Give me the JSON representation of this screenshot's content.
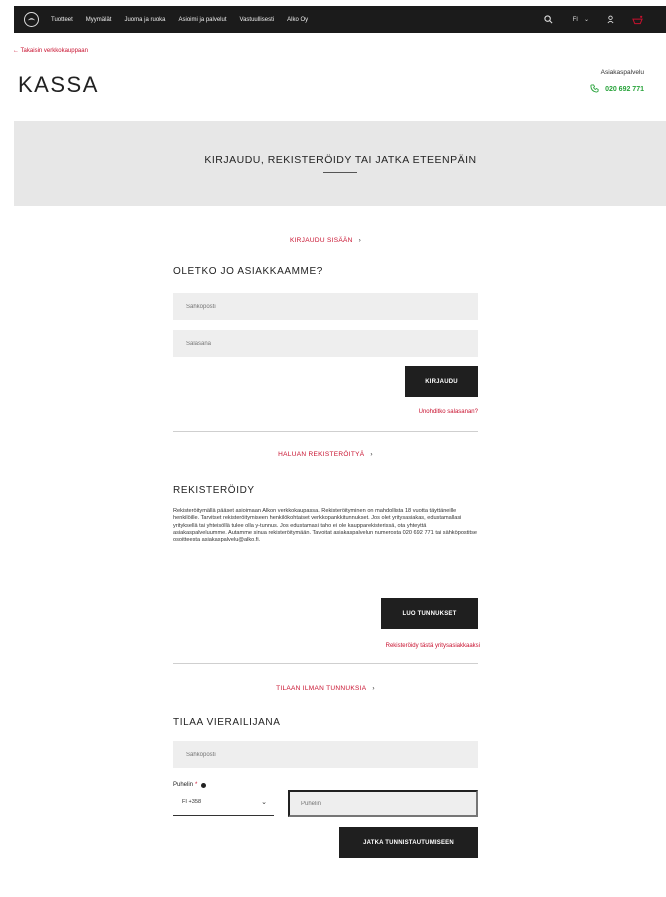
{
  "header": {
    "nav": [
      "Tuotteet",
      "Myymälät",
      "Juoma ja ruoka",
      "Asioimi ja palvelut",
      "Vastuullisesti",
      "Alko Oy"
    ],
    "language": "FI"
  },
  "back_link": "← Takaisin verkkokauppaan",
  "page_title": "KASSA",
  "customer_service": {
    "label": "Asiakaspalvelu",
    "phone": "020 692 771"
  },
  "hero": {
    "title": "KIRJAUDU, REKISTERÖIDY TAI JATKA ETEENPÄIN"
  },
  "login": {
    "toggle": "KIRJAUDU SISÄÄN",
    "heading": "OLETKO JO ASIAKKAAMME?",
    "email_placeholder": "Sähköposti",
    "password_placeholder": "Salasana",
    "button": "KIRJAUDU",
    "forgot": "Unohditko salasanan?"
  },
  "register": {
    "toggle": "HALUAN REKISTERÖITYÄ",
    "heading": "REKISTERÖIDY",
    "paragraph": "Rekisteröitymällä pääset asioimaan Alkon verkkokaupassa. Rekisteröityminen on mahdollista 18 vuotta täyttäneille henkilöille. Tarvitset rekisteröitymiseen henkilökohtaiset verkkopankkitunnukset. Jos olet yritysasiakas, edustamallasi yrityksellä tai yhteisöllä tulee olla y-tunnus. Jos edustamasi taho ei ole kaupparekisterissä, ota yhteyttä asiakaspalveluumme. Autamme sinua rekisteröitymään. Tavoitat asiakaspalvelun numerosta 020 692 771 tai sähköpostitse osoitteesta asiakaspalvelu@alko.fi.",
    "button": "LUO TUNNUKSET",
    "business_link": "Rekisteröidy tästä yritysasiakkaaksi"
  },
  "guest": {
    "toggle": "TILAAN ILMAN TUNNUKSIA",
    "heading": "TILAA VIERAILIJANA",
    "email_placeholder": "Sähköposti",
    "phone_label": "Puhelin",
    "required_mark": "*",
    "country_code": "FI +358",
    "phone_placeholder": "Puhelin",
    "button": "JATKA TUNNISTAUTUMISEEN"
  },
  "colors": {
    "accent_red": "#c8102e",
    "phone_green": "#27a33a",
    "topbar": "#1b1b1b",
    "button": "#1f1f1f"
  }
}
